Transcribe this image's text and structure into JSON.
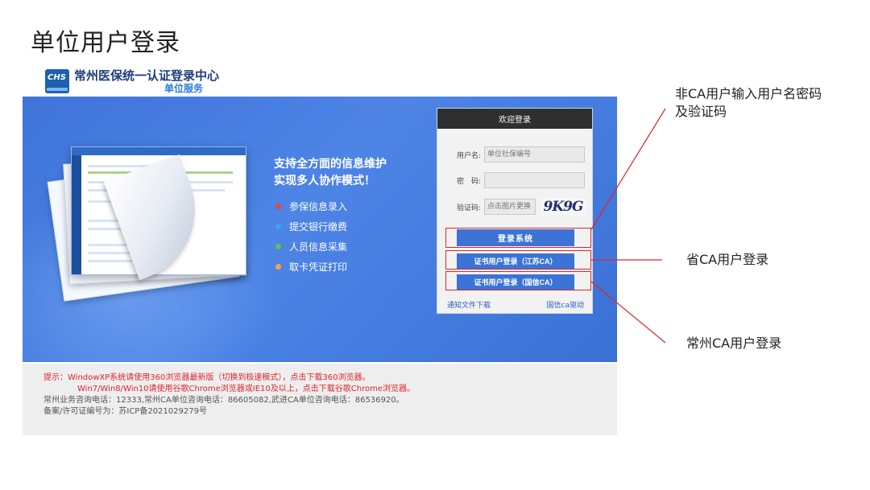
{
  "slide": {
    "title": "单位用户登录"
  },
  "brand": {
    "logo_text": "CHS",
    "main": "常州医保统一认证登录中心",
    "sub": "单位服务"
  },
  "banner": {
    "slogan_line1": "支持全方面的信息维护",
    "slogan_line2": "实现多人协作模式！",
    "features": [
      {
        "label": "参保信息录入",
        "color": "#e8434a"
      },
      {
        "label": "提交银行缴费",
        "color": "#3fa2ea"
      },
      {
        "label": "人员信息采集",
        "color": "#5fc24a"
      },
      {
        "label": "取卡凭证打印",
        "color": "#f2a93b"
      }
    ]
  },
  "login": {
    "header": "欢迎登录",
    "username_label": "用户名:",
    "username_placeholder": "单位社保编号",
    "password_label": "密　码:",
    "captcha_label": "验证码:",
    "captcha_placeholder": "点击图片更换",
    "captcha_text": "9K9G",
    "login_button": "登录系统",
    "ca_js_button": "证书用户登录（江苏CA）",
    "ca_gx_button": "证书用户登录（国信CA）",
    "link_notice": "通知文件下载",
    "link_driver": "国信ca驱动"
  },
  "footer": {
    "tip1": "提示：WindowXP系统请使用360浏览器最新版（切换到极速模式），点击下载360浏览器。",
    "tip2": "Win7/Win8/Win10请使用谷歌Chrome浏览器或IE10及以上，点击下载谷歌Chrome浏览器。",
    "contact": "常州业务咨询电话：12333,常州CA单位咨询电话：86605082,武进CA单位咨询电话：86536920。",
    "icp": "备案/许可证编号为：苏ICP备2021029279号"
  },
  "annotations": {
    "non_ca_line1": "非CA用户输入用户名密码",
    "non_ca_line2": "及验证码",
    "province_ca": "省CA用户登录",
    "changzhou_ca": "常州CA用户登录",
    "highlight_color": "#e0242a"
  }
}
